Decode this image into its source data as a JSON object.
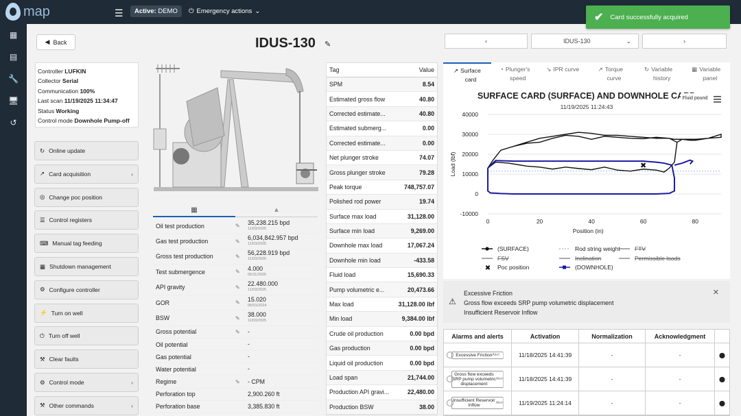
{
  "app": {
    "logo_text": "map",
    "active_label": "Active:",
    "active_value": "DEMO",
    "emergency": "Emergency actions"
  },
  "toast": {
    "message": "Card successfully acquired"
  },
  "header": {
    "back": "Back",
    "title": "IDUS-130",
    "well_selector": "IDUS-130"
  },
  "info": {
    "controller_label": "Controller",
    "controller": "LUFKIN",
    "collector_label": "Collector",
    "collector": "Serial",
    "communication_label": "Communication",
    "communication": "100%",
    "last_scan_label": "Last scan",
    "last_scan": "11/19/2025 11:34:47",
    "status_label": "Status",
    "status": "Working",
    "control_mode_label": "Control mode",
    "control_mode": "Downhole Pump-off"
  },
  "commands": [
    {
      "label": "Online update",
      "icon": "refresh-icon",
      "arrow": false
    },
    {
      "label": "Card acquisition",
      "icon": "chart-icon",
      "arrow": true
    },
    {
      "label": "Change poc position",
      "icon": "target-icon",
      "arrow": false
    },
    {
      "label": "Control registers",
      "icon": "list-icon",
      "arrow": false
    },
    {
      "label": "Manual tag feeding",
      "icon": "keyboard-icon",
      "arrow": false
    },
    {
      "label": "Shutdown management",
      "icon": "calendar-icon",
      "arrow": false
    },
    {
      "label": "Configure controller",
      "icon": "gear-icon",
      "arrow": false
    },
    {
      "label": "Turn on well",
      "icon": "bolt-icon",
      "arrow": false
    },
    {
      "label": "Turn off well",
      "icon": "power-icon",
      "arrow": false
    },
    {
      "label": "Clear faults",
      "icon": "tools-icon",
      "arrow": false
    },
    {
      "label": "Control mode",
      "icon": "gear-icon",
      "arrow": true
    },
    {
      "label": "Other commands",
      "icon": "wrench-icon",
      "arrow": true
    }
  ],
  "production": [
    {
      "label": "Oil test production",
      "value": "35,238.215 bpd",
      "date": "11/03/2025"
    },
    {
      "label": "Gas test production",
      "value": "6,034,842.957 bpd",
      "date": "11/03/2025"
    },
    {
      "label": "Gross test production",
      "value": "56,228.919 bpd",
      "date": "11/03/2025"
    },
    {
      "label": "Test submergence",
      "value": "4.000",
      "date": "05/11/2025"
    },
    {
      "label": "API gravity",
      "value": "22.480.000",
      "date": "11/03/2025"
    },
    {
      "label": "GOR",
      "value": "15.020",
      "date": "05/01/2024"
    },
    {
      "label": "BSW",
      "value": "38.000",
      "date": "11/03/2025"
    },
    {
      "label": "Gross potential",
      "value": "-",
      "date": ""
    },
    {
      "label": "Oil potential",
      "value": "-",
      "date": ""
    },
    {
      "label": "Gas potential",
      "value": "-",
      "date": ""
    },
    {
      "label": "Water potential",
      "value": "-",
      "date": ""
    },
    {
      "label": "Regime",
      "value": "- CPM",
      "date": ""
    },
    {
      "label": "Perforation top",
      "value": "2,900.260 ft",
      "date": ""
    },
    {
      "label": "Perforation base",
      "value": "3,385.830 ft",
      "date": ""
    }
  ],
  "tags": {
    "header_tag": "Tag",
    "header_value": "Value",
    "rows": [
      {
        "tag": "SPM",
        "value": "8.54"
      },
      {
        "tag": "Estimated gross flow",
        "value": "40.80"
      },
      {
        "tag": "Corrected estimate...",
        "value": "40.80"
      },
      {
        "tag": "Estimated submerg...",
        "value": "0.00"
      },
      {
        "tag": "Corrected estimate...",
        "value": "0.00"
      },
      {
        "tag": "Net plunger stroke",
        "value": "74.07"
      },
      {
        "tag": "Gross plunger stroke",
        "value": "79.28"
      },
      {
        "tag": "Peak torque",
        "value": "748,757.07"
      },
      {
        "tag": "Polished rod power",
        "value": "19.74"
      },
      {
        "tag": "Surface max load",
        "value": "31,128.00"
      },
      {
        "tag": "Surface min load",
        "value": "9,269.00"
      },
      {
        "tag": "Downhole max load",
        "value": "17,067.24"
      },
      {
        "tag": "Downhole min load",
        "value": "-433.58"
      },
      {
        "tag": "Fluid load",
        "value": "15,690.33"
      },
      {
        "tag": "Pump volumetric e...",
        "value": "20,473.66"
      },
      {
        "tag": "Max load",
        "value": "31,128.00 lbf"
      },
      {
        "tag": "Min load",
        "value": "9,384.00 lbf"
      },
      {
        "tag": "Crude oil production",
        "value": "0.00 bpd"
      },
      {
        "tag": "Gas production",
        "value": "0.00 bpd"
      },
      {
        "tag": "Liquid oil production",
        "value": "0.00 bpd"
      },
      {
        "tag": "Load span",
        "value": "21,744.00"
      },
      {
        "tag": "Production API gravi...",
        "value": "22,480.00"
      },
      {
        "tag": "Production BSW",
        "value": "38.00"
      }
    ]
  },
  "chart_tabs": [
    {
      "l1": "Surface",
      "l2": "card",
      "icon": "surface-card-icon"
    },
    {
      "l1": "Plunger's",
      "l2": "speed",
      "icon": "speed-icon"
    },
    {
      "l1": "IPR curve",
      "l2": "",
      "icon": "ipr-icon"
    },
    {
      "l1": "Torque",
      "l2": "curve",
      "icon": "torque-icon"
    },
    {
      "l1": "Variable",
      "l2": "history",
      "icon": "history-icon"
    },
    {
      "l1": "Variable",
      "l2": "panel",
      "icon": "panel-icon"
    }
  ],
  "chart_data": {
    "type": "line",
    "title": "SURFACE CARD (SURFACE) AND DOWNHOLE CARD",
    "subtitle": "11/19/2025 11:24:43",
    "corner_label": "Fluid pound",
    "xlabel": "Position (in)",
    "ylabel": "Load (lbf)",
    "xlim": [
      0,
      90
    ],
    "ylim": [
      -10000,
      40000
    ],
    "xticks": [
      0,
      20,
      40,
      60,
      80
    ],
    "yticks": [
      -10000,
      0,
      10000,
      20000,
      30000,
      40000
    ],
    "poc_position": {
      "x": 60,
      "y": 14500
    },
    "series": [
      {
        "name": "(SURFACE)",
        "color": "#111111",
        "x": [
          0,
          2,
          5,
          10,
          15,
          20,
          25,
          30,
          35,
          40,
          45,
          50,
          55,
          60,
          65,
          70,
          72,
          75,
          78,
          80,
          85,
          90,
          90,
          85,
          80,
          75,
          73,
          70,
          65,
          60,
          55,
          50,
          45,
          40,
          35,
          30,
          25,
          20,
          15,
          10,
          5,
          2,
          0
        ],
        "y": [
          13000,
          17000,
          22000,
          24000,
          25500,
          26000,
          28000,
          29500,
          29000,
          27500,
          29000,
          28500,
          28000,
          27800,
          28500,
          28000,
          27500,
          27500,
          27000,
          27000,
          28000,
          28500,
          30000,
          28000,
          27500,
          27500,
          26000,
          28000,
          28000,
          28500,
          29000,
          29500,
          29500,
          30500,
          31000,
          30000,
          29000,
          28000,
          26000,
          24000,
          22000,
          17000,
          13000
        ]
      },
      {
        "name": "(SURFACE) lower",
        "color": "#111111",
        "x": [
          0,
          3,
          8,
          15,
          20,
          25,
          30,
          35,
          40,
          45,
          50,
          55,
          60,
          65,
          68,
          70,
          72,
          73
        ],
        "y": [
          13000,
          16000,
          15500,
          14000,
          13500,
          12500,
          13500,
          12800,
          12200,
          13500,
          12000,
          11500,
          12500,
          12000,
          11000,
          13000,
          16000,
          26000
        ]
      },
      {
        "name": "(DOWNHOLE)",
        "color": "#1a1aa0",
        "x": [
          0,
          0,
          1,
          5,
          10,
          20,
          30,
          40,
          50,
          60,
          65,
          70,
          72,
          72,
          71,
          68,
          65,
          60,
          50,
          40,
          30,
          20,
          10,
          3,
          0
        ],
        "y": [
          13000,
          1500,
          500,
          200,
          0,
          0,
          0,
          0,
          0,
          0,
          0,
          300,
          1500,
          8000,
          14500,
          15500,
          16000,
          16500,
          16500,
          16500,
          16500,
          16500,
          16500,
          16800,
          13000
        ]
      },
      {
        "name": "(DOWNHOLE) tail",
        "color": "#1a1aa0",
        "x": [
          72,
          75,
          78,
          79,
          78
        ],
        "y": [
          14500,
          15500,
          17000,
          16500,
          15000
        ]
      }
    ],
    "legend": [
      {
        "label": "(SURFACE)",
        "style": "solid-dot",
        "color": "#111111"
      },
      {
        "label": "Rod string weight",
        "style": "dotted",
        "color": "#999999"
      },
      {
        "label": "FTV",
        "style": "strike-star",
        "color": "#555555"
      },
      {
        "label": "FSV",
        "style": "strike-star",
        "color": "#555555"
      },
      {
        "label": "Inclination",
        "style": "strike-dot",
        "color": "#555555"
      },
      {
        "label": "Permissible loads",
        "style": "strike-dot",
        "color": "#555555"
      },
      {
        "label": "Poc position",
        "style": "x",
        "color": "#111111"
      },
      {
        "label": "(DOWNHOLE)",
        "style": "solid-square",
        "color": "#1a1aa0"
      }
    ]
  },
  "alert": {
    "lines": [
      "Excessive Friction",
      "Gross flow exceeds SRP pump volumetric displacement",
      "Insufficient Reservoir Inflow"
    ]
  },
  "alarms": {
    "headers": [
      "Alarms and alerts",
      "Activation",
      "Normalization",
      "Acknowledgment"
    ],
    "rows": [
      {
        "name": "Excessive Friction",
        "type": "Alert",
        "activation": "11/18/2025 14:41:39",
        "normalization": "-",
        "ack": "-"
      },
      {
        "name": "Gross flow exceeds SRP pump volumetric displacement",
        "type": "Alert",
        "activation": "11/18/2025 14:41:39",
        "normalization": "-",
        "ack": "-"
      },
      {
        "name": "Insufficient Reservoir Inflow",
        "type": "Alert",
        "activation": "11/19/2025 11:24:14",
        "normalization": "-",
        "ack": "-"
      }
    ]
  }
}
